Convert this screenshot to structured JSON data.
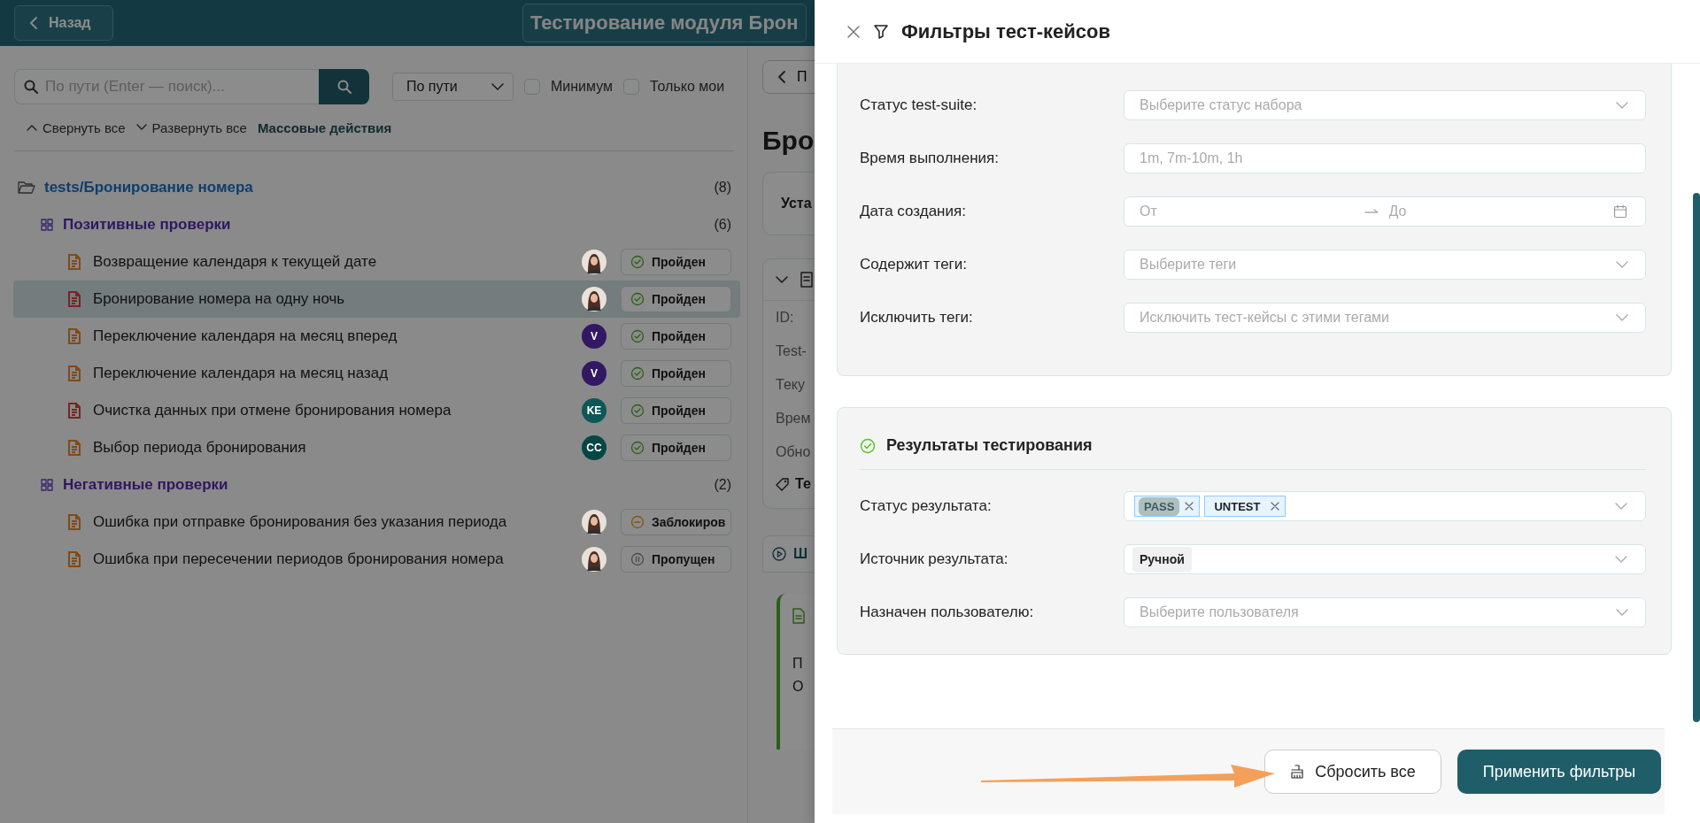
{
  "header": {
    "back_button": "Назад",
    "title": "Тестирование модуля Брон"
  },
  "search": {
    "placeholder": "По пути (Enter — поиск)...",
    "mode": "По пути",
    "options": [
      {
        "label": "Минимум",
        "checked": false
      },
      {
        "label": "Только мои",
        "checked": false
      }
    ]
  },
  "tree_actions": [
    {
      "kind": "collapse",
      "label": "Свернуть все"
    },
    {
      "kind": "expand",
      "label": "Развернуть все"
    },
    {
      "kind": "bulk",
      "label": "Массовые действия"
    }
  ],
  "tree": {
    "label": "tests/Бронирование номера",
    "count": "(8)",
    "children": [
      {
        "label": "Позитивные проверки",
        "count": "(6)",
        "children": [
          {
            "title": "Возвращение календаря к текущей дате",
            "color": "#804b18",
            "selected": false,
            "avatar": {
              "kind": "photo"
            },
            "status": {
              "kind": "passed",
              "label": "Пройден"
            }
          },
          {
            "title": "Бронирование номера на одну ночь",
            "color": "#772620",
            "selected": true,
            "avatar": {
              "kind": "photo"
            },
            "status": {
              "kind": "passed",
              "label": "Пройден"
            }
          },
          {
            "title": "Переключение календаря на месяц вперед",
            "color": "#804b18",
            "selected": false,
            "avatar": {
              "kind": "initials",
              "text": "V",
              "color": "#321863"
            },
            "status": {
              "kind": "passed",
              "label": "Пройден"
            }
          },
          {
            "title": "Переключение календаря на месяц назад",
            "color": "#804b18",
            "selected": false,
            "avatar": {
              "kind": "initials",
              "text": "V",
              "color": "#321863"
            },
            "status": {
              "kind": "passed",
              "label": "Пройден"
            }
          },
          {
            "title": "Очистка данных при отмене бронирования номера",
            "color": "#772620",
            "selected": false,
            "avatar": {
              "kind": "initials",
              "text": "KE",
              "color": "#0e5757"
            },
            "status": {
              "kind": "passed",
              "label": "Пройден"
            }
          },
          {
            "title": "Выбор периода бронирования",
            "color": "#804b18",
            "selected": false,
            "avatar": {
              "kind": "initials",
              "text": "CC",
              "color": "#084646"
            },
            "status": {
              "kind": "passed",
              "label": "Пройден"
            }
          }
        ]
      },
      {
        "label": "Негативные проверки",
        "count": "(2)",
        "children": [
          {
            "title": "Ошибка при отправке бронирования без указания периода",
            "color": "#804b18",
            "selected": false,
            "avatar": {
              "kind": "photo"
            },
            "status": {
              "kind": "blocked",
              "label": "Заблокиров"
            }
          },
          {
            "title": "Ошибка при пересечении периодов бронирования номера",
            "color": "#804b18",
            "selected": false,
            "avatar": {
              "kind": "photo"
            },
            "status": {
              "kind": "skipped",
              "label": "Пропущен"
            }
          }
        ]
      }
    ]
  },
  "detail_peek": {
    "back_button": "П",
    "heading": "Бро",
    "card_label": "Уста",
    "fields": [
      "ID:",
      "Test-",
      "Теку",
      "Врем",
      "Обно"
    ],
    "tags_label": "Те",
    "tab": "Ш",
    "step_lines": [
      "П",
      "О"
    ]
  },
  "drawer": {
    "title": "Фильтры тест-кейсов",
    "sections": [
      {
        "fields": [
          {
            "kind": "select",
            "label": "Статус test-suite:",
            "placeholder": "Выберите статус набора"
          },
          {
            "kind": "input",
            "label": "Время выполнения:",
            "placeholder": "1m, 7m-10m, 1h"
          },
          {
            "kind": "daterange",
            "label": "Дата создания:",
            "from_placeholder": "От",
            "to_placeholder": "До"
          },
          {
            "kind": "select",
            "label": "Содержит теги:",
            "placeholder": "Выберите теги"
          },
          {
            "kind": "select",
            "label": "Исключить теги:",
            "placeholder": "Исключить тест-кейсы с этими тегами"
          }
        ]
      },
      {
        "title": "Результаты тестирования",
        "fields": [
          {
            "kind": "tags",
            "label": "Статус результата:",
            "tags": [
              {
                "label": "PASS",
                "highlighted": true
              },
              {
                "label": "UNTEST",
                "highlighted": false
              }
            ]
          },
          {
            "kind": "single",
            "label": "Источник результата:",
            "value": "Ручной"
          },
          {
            "kind": "select",
            "label": "Назначен пользователю:",
            "placeholder": "Выберите пользователя"
          }
        ]
      }
    ],
    "buttons": [
      {
        "kind": "reset",
        "label": "Сбросить все"
      },
      {
        "kind": "apply",
        "label": "Применить фильтры"
      }
    ]
  }
}
